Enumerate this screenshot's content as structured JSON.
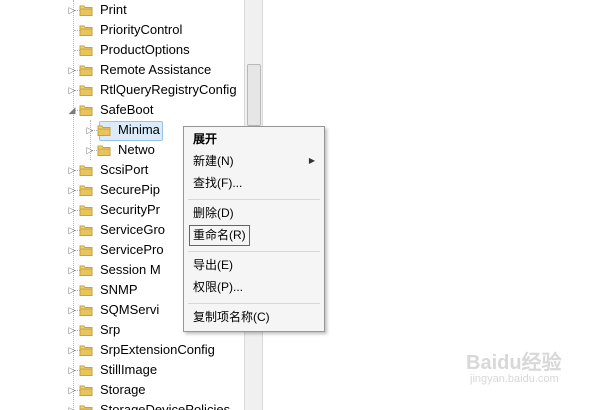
{
  "tree": {
    "items": [
      {
        "label": "Print",
        "expander": "▷"
      },
      {
        "label": "PriorityControl",
        "expander": ""
      },
      {
        "label": "ProductOptions",
        "expander": ""
      },
      {
        "label": "Remote Assistance",
        "expander": "▷"
      },
      {
        "label": "RtlQueryRegistryConfig",
        "expander": "▷"
      },
      {
        "label": "SafeBoot",
        "expander": "◢"
      },
      {
        "label": "Minima",
        "expander": "▷",
        "child": true,
        "selected": true
      },
      {
        "label": "Netwo",
        "expander": "▷",
        "child": true
      },
      {
        "label": "ScsiPort",
        "expander": "▷"
      },
      {
        "label": "SecurePip",
        "expander": "▷"
      },
      {
        "label": "SecurityPr",
        "expander": "▷"
      },
      {
        "label": "ServiceGro",
        "expander": "▷"
      },
      {
        "label": "ServicePro",
        "expander": "▷"
      },
      {
        "label": "Session M",
        "expander": "▷"
      },
      {
        "label": "SNMP",
        "expander": "▷"
      },
      {
        "label": "SQMServi",
        "expander": "▷"
      },
      {
        "label": "Srp",
        "expander": "▷"
      },
      {
        "label": "SrpExtensionConfig",
        "expander": "▷"
      },
      {
        "label": "StillImage",
        "expander": "▷"
      },
      {
        "label": "Storage",
        "expander": "▷"
      },
      {
        "label": "StorageDevicePolicies",
        "expander": "▷"
      }
    ]
  },
  "context_menu": {
    "expand": "展开",
    "new": "新建(N)",
    "find": "查找(F)...",
    "delete": "删除(D)",
    "rename": "重命名(R)",
    "export": "导出(E)",
    "permissions": "权限(P)...",
    "copy_key_name": "复制项名称(C)",
    "submenu_arrow": "▶"
  },
  "watermark": {
    "text": "Baidu经验",
    "url": "jingyan.baidu.com"
  },
  "colors": {
    "folder": "#e8c45a",
    "selection": "#dcebfa",
    "highlight_box": "#d9342b"
  }
}
